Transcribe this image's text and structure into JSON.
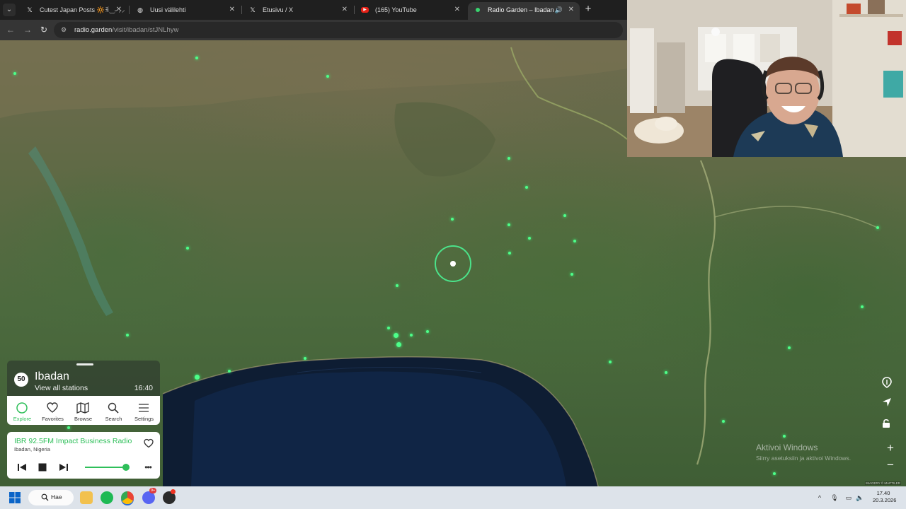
{
  "browser": {
    "tabs": [
      {
        "label": "Cutest Japan Posts 🔆ꉂ‿˶ ⸝⸝",
        "favicon": "x-logo-icon",
        "active": false
      },
      {
        "label": "Uusi välilehti",
        "favicon": "chrome-icon",
        "active": false
      },
      {
        "label": "Etusivu / X",
        "favicon": "x-logo-icon",
        "active": false
      },
      {
        "label": "(165) YouTube",
        "favicon": "youtube-icon",
        "active": false
      },
      {
        "label": "Radio Garden – Ibadan",
        "favicon": "radio-garden-icon",
        "active": true
      }
    ],
    "address": {
      "host": "radio.garden",
      "path": "/visit/ibadan/stJNLhyw"
    }
  },
  "radio_garden": {
    "city": {
      "count": "50",
      "name": "Ibadan",
      "view_all": "View all stations",
      "local_time": "16:40"
    },
    "nav": [
      {
        "label": "Explore",
        "icon": "explore-icon",
        "active": true
      },
      {
        "label": "Favorites",
        "icon": "heart-icon",
        "active": false
      },
      {
        "label": "Browse",
        "icon": "map-icon",
        "active": false
      },
      {
        "label": "Search",
        "icon": "search-icon",
        "active": false
      },
      {
        "label": "Settings",
        "icon": "settings-icon",
        "active": false
      }
    ],
    "player": {
      "station": "IBR 92.5FM Impact Business Radio",
      "location": "Ibadan, Nigeria",
      "volume": 1.0
    },
    "accent_color": "#2fbf5a",
    "map_controls": [
      "marker-icon",
      "locate-icon",
      "lock-icon",
      "zoom-in-icon",
      "zoom-out-icon"
    ],
    "credit": "IMAGERY © MAPTILER"
  },
  "watermark": {
    "line1": "Aktivoi Windows",
    "line2": "Siirry asetuksiin ja aktivoi Windows."
  },
  "taskbar": {
    "search_label": "Hae",
    "time": "17.40",
    "date": "20.3.2026",
    "notification_badge": "9+"
  }
}
